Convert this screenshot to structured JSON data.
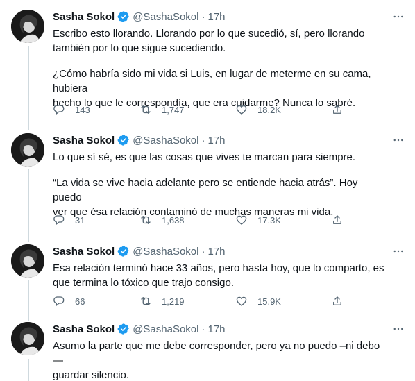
{
  "tweets": [
    {
      "name": "Sasha Sokol",
      "handle": "@SashaSokol",
      "dot": "·",
      "time": "17h",
      "paragraphs": [
        "Escribo esto llorando. Llorando por lo que sucedió, sí, pero llorando\ntambién por lo que sigue sucediendo.",
        "¿Cómo habría sido mi vida si Luis, en lugar de meterme en su cama, hubiera\nhecho lo que le correspondía, que era cuidarme? Nunca lo sabré."
      ],
      "replies": "143",
      "retweets": "1,747",
      "likes": "18.2K"
    },
    {
      "name": "Sasha Sokol",
      "handle": "@SashaSokol",
      "dot": "·",
      "time": "17h",
      "paragraphs": [
        "Lo que sí sé, es que las cosas que vives te marcan para siempre.",
        "“La vida se vive hacia adelante pero se entiende hacia atrás”. Hoy puedo\nver que ésa relación contaminó de muchas maneras mi vida."
      ],
      "replies": "31",
      "retweets": "1,638",
      "likes": "17.3K"
    },
    {
      "name": "Sasha Sokol",
      "handle": "@SashaSokol",
      "dot": "·",
      "time": "17h",
      "paragraphs": [
        "Esa relación terminó hace 33 años, pero hasta hoy, que lo comparto, es\nque termina lo tóxico que trajo consigo."
      ],
      "replies": "66",
      "retweets": "1,219",
      "likes": "15.9K"
    },
    {
      "name": "Sasha Sokol",
      "handle": "@SashaSokol",
      "dot": "·",
      "time": "17h",
      "paragraphs": [
        "Asumo la parte que me debe corresponder, pero ya no puedo –ni debo—\nguardar silencio."
      ]
    }
  ],
  "icons": {
    "avatar": "avatar-photo",
    "verified": "verified-badge-icon",
    "more": "more-options-icon",
    "reply": "reply-icon",
    "retweet": "retweet-icon",
    "like": "heart-icon",
    "share": "share-icon"
  },
  "colors": {
    "text": "#0f1419",
    "secondary": "#536471",
    "verified": "#1d9bf0",
    "thread_line": "#cfd9de"
  }
}
